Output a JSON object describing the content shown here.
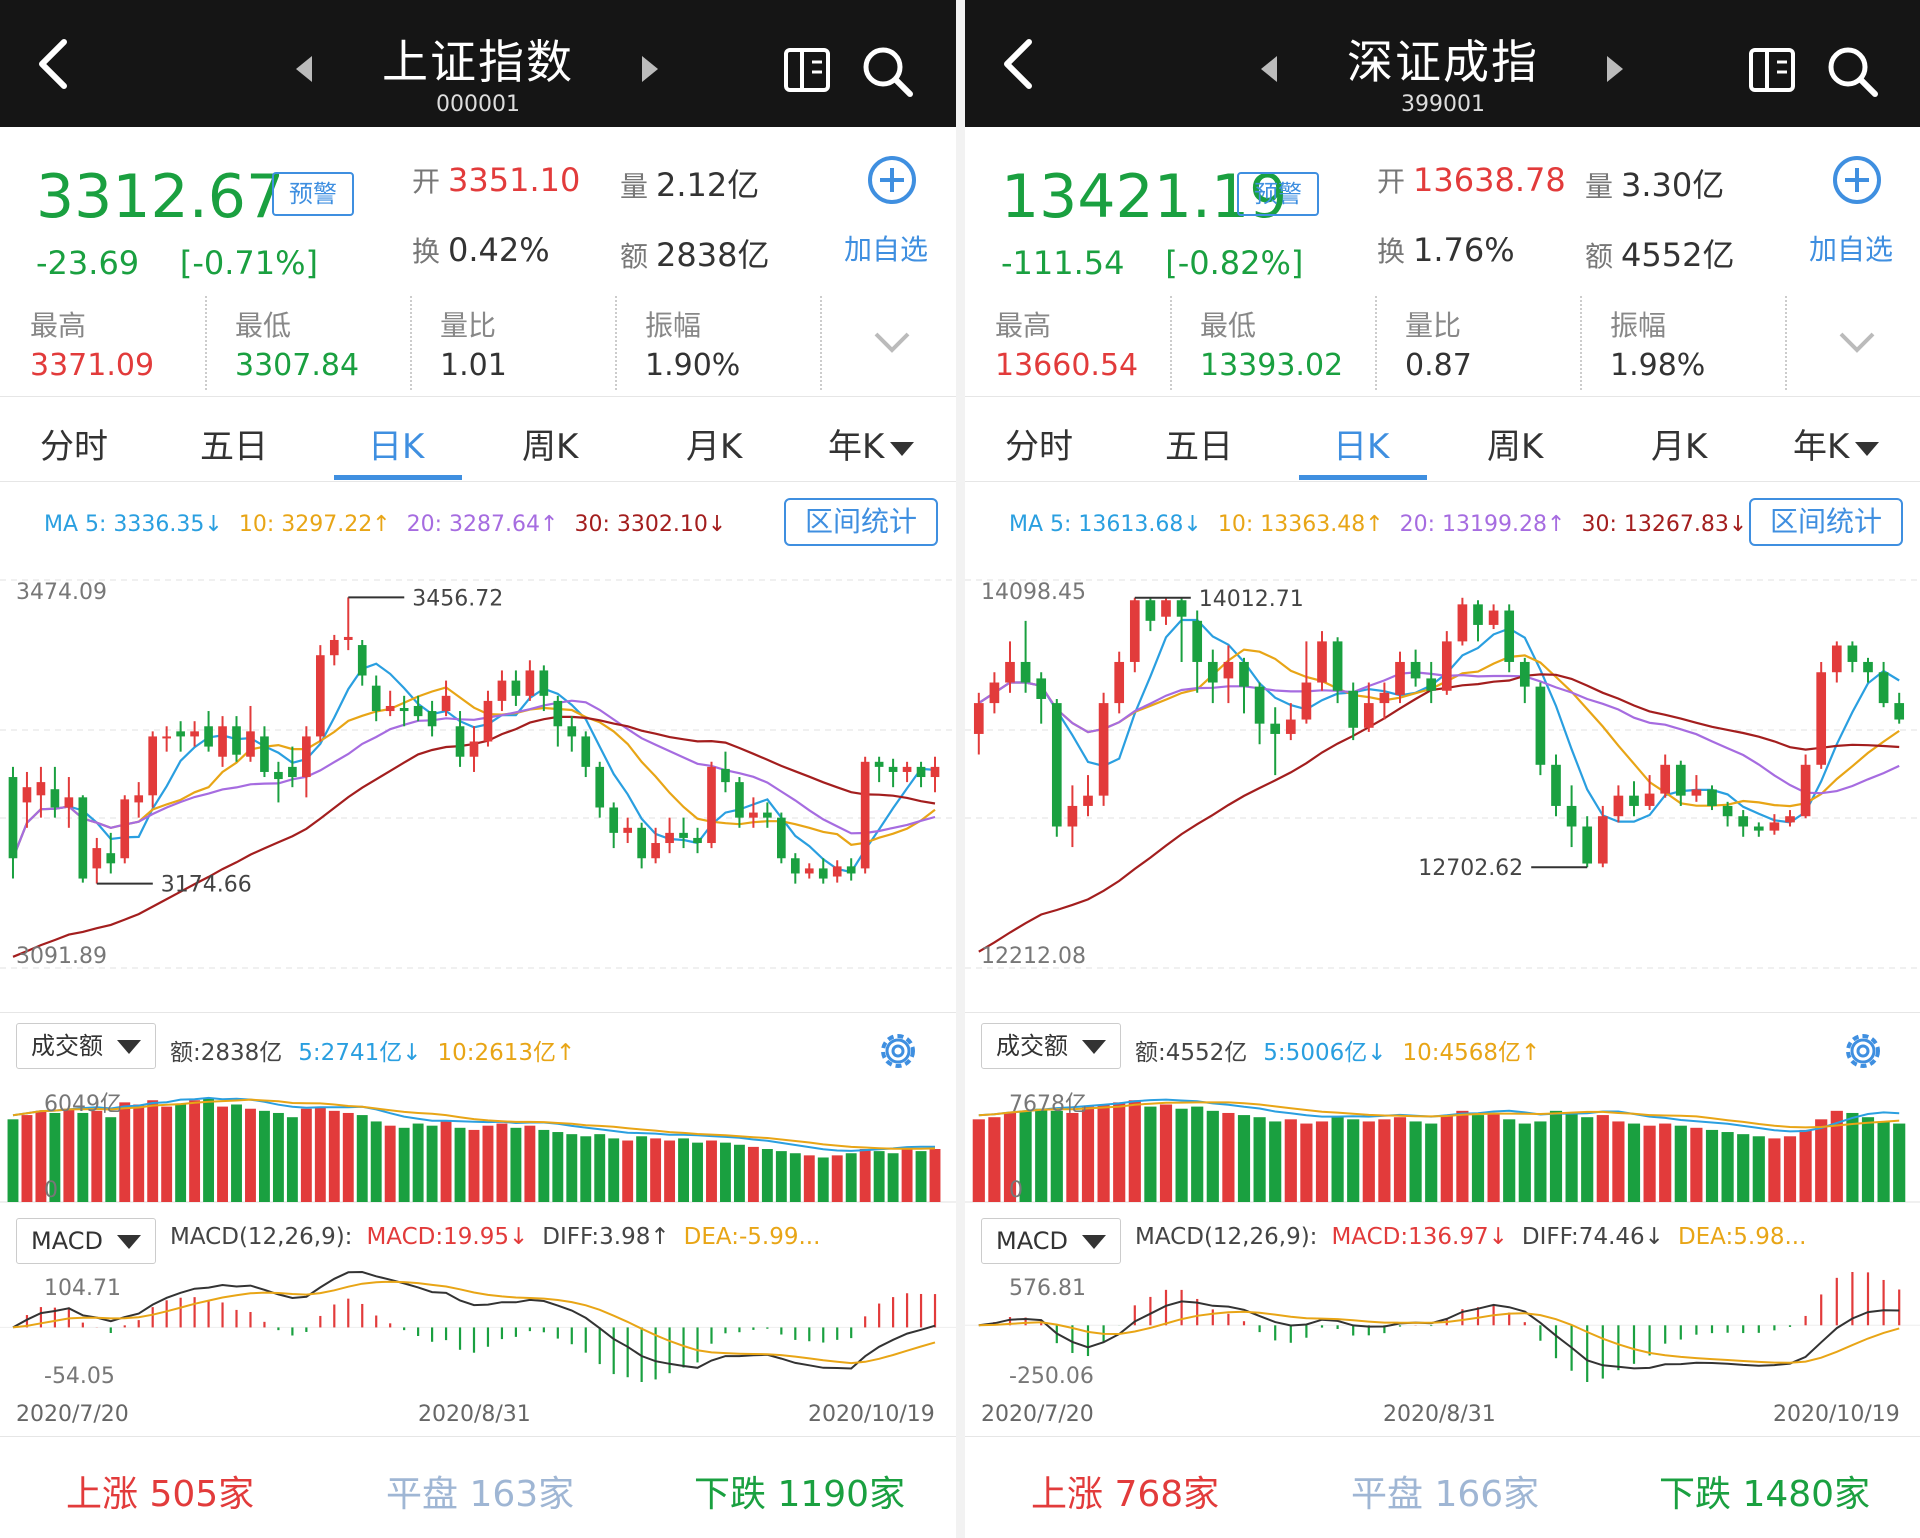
{
  "colors": {
    "up": "#e23b3b",
    "down": "#1aa040",
    "accent": "#3f8fe0",
    "ma5": "#2a9fe0",
    "ma10": "#e8a516",
    "ma20": "#a66ce0",
    "ma30": "#a31e1e"
  },
  "icons": [
    "back-arrow-icon",
    "prev-triangle-icon",
    "next-triangle-icon",
    "screen-toggle-icon",
    "search-icon",
    "plus-circle-icon",
    "chevron-down-icon",
    "gear-icon"
  ],
  "panels": [
    {
      "title": "上证指数",
      "code": "000001",
      "price": "3312.67",
      "warn": "预警",
      "change": "-23.69    [-0.71%]",
      "open_k": "开",
      "open": "3351.10",
      "vol_k": "量",
      "vol": "2.12亿",
      "turn_k": "换",
      "turn": "0.42%",
      "amt_k": "额",
      "amt": "2838亿",
      "add_label": "加自选",
      "stats": [
        {
          "label": "最高",
          "value": "3371.09",
          "color": "#e23b3b"
        },
        {
          "label": "最低",
          "value": "3307.84",
          "color": "#1aa040"
        },
        {
          "label": "量比",
          "value": "1.01",
          "color": "#333"
        },
        {
          "label": "振幅",
          "value": "1.90%",
          "color": "#333"
        }
      ],
      "tabs": [
        "分时",
        "五日",
        "日K",
        "周K",
        "月K",
        "年K"
      ],
      "active_tab": 2,
      "ma": {
        "ma5": "MA 5: 3336.35↓",
        "ma10": "10: 3297.22↑",
        "ma20": "20: 3287.64↑",
        "ma30": "30: 3302.10↓"
      },
      "range_btn": "区间统计",
      "k_axis": {
        "top": "3474.09",
        "bottom": "3091.89",
        "max_label": "3456.72",
        "min_label": "3174.66"
      },
      "vol_dropdown": "成交额",
      "vol_info": {
        "amt": "额:2838亿",
        "ma5": "5:2741亿↓",
        "ma10": "10:2613亿↑"
      },
      "vol_axis": {
        "top": "6049亿",
        "bottom": "0"
      },
      "macd_dropdown": "MACD",
      "macd_info": {
        "params": "MACD(12,26,9):",
        "macd": "MACD:19.95↓",
        "diff": "DIFF:3.98↑",
        "dea": "DEA:-5.99..."
      },
      "macd_axis": {
        "top": "104.71",
        "bottom": "-54.05"
      },
      "dates": [
        "2020/7/20",
        "2020/8/31",
        "2020/10/19"
      ],
      "breadth": {
        "up_k": "上涨",
        "up": "505家",
        "flat_k": "平盘",
        "flat": "163家",
        "down_k": "下跌",
        "down": "1190家"
      },
      "chart_data": {
        "type": "candlestick",
        "ylim": [
          3091.89,
          3474.09
        ],
        "candles": [
          [
            3280,
            3200,
            3290,
            3180
          ],
          [
            3255,
            3270,
            3285,
            3230
          ],
          [
            3262,
            3275,
            3290,
            3240
          ],
          [
            3268,
            3250,
            3290,
            3240
          ],
          [
            3250,
            3260,
            3280,
            3230
          ],
          [
            3260,
            3180,
            3262,
            3176
          ],
          [
            3190,
            3210,
            3220,
            3175
          ],
          [
            3205,
            3195,
            3225,
            3185
          ],
          [
            3200,
            3258,
            3262,
            3195
          ],
          [
            3255,
            3262,
            3275,
            3240
          ],
          [
            3262,
            3320,
            3325,
            3250
          ],
          [
            3318,
            3320,
            3330,
            3305
          ],
          [
            3325,
            3320,
            3335,
            3305
          ],
          [
            3320,
            3325,
            3335,
            3310
          ],
          [
            3330,
            3310,
            3345,
            3305
          ],
          [
            3300,
            3330,
            3340,
            3290
          ],
          [
            3330,
            3302,
            3340,
            3295
          ],
          [
            3300,
            3325,
            3350,
            3295
          ],
          [
            3320,
            3285,
            3330,
            3280
          ],
          [
            3285,
            3278,
            3295,
            3255
          ],
          [
            3290,
            3280,
            3310,
            3270
          ],
          [
            3280,
            3320,
            3330,
            3260
          ],
          [
            3320,
            3400,
            3410,
            3315
          ],
          [
            3400,
            3415,
            3420,
            3390
          ],
          [
            3415,
            3418,
            3457,
            3405
          ],
          [
            3410,
            3380,
            3415,
            3370
          ],
          [
            3370,
            3345,
            3380,
            3335
          ],
          [
            3345,
            3350,
            3365,
            3340
          ],
          [
            3348,
            3345,
            3360,
            3330
          ],
          [
            3350,
            3340,
            3360,
            3335
          ],
          [
            3345,
            3330,
            3355,
            3320
          ],
          [
            3345,
            3360,
            3375,
            3340
          ],
          [
            3330,
            3300,
            3345,
            3290
          ],
          [
            3300,
            3315,
            3330,
            3285
          ],
          [
            3315,
            3355,
            3365,
            3310
          ],
          [
            3355,
            3375,
            3385,
            3345
          ],
          [
            3375,
            3360,
            3385,
            3350
          ],
          [
            3360,
            3385,
            3395,
            3355
          ],
          [
            3385,
            3360,
            3390,
            3345
          ],
          [
            3355,
            3330,
            3360,
            3310
          ],
          [
            3330,
            3320,
            3340,
            3305
          ],
          [
            3320,
            3290,
            3325,
            3280
          ],
          [
            3290,
            3250,
            3295,
            3240
          ],
          [
            3250,
            3225,
            3255,
            3210
          ],
          [
            3225,
            3230,
            3240,
            3215
          ],
          [
            3230,
            3200,
            3235,
            3190
          ],
          [
            3200,
            3215,
            3230,
            3195
          ],
          [
            3215,
            3225,
            3240,
            3205
          ],
          [
            3225,
            3220,
            3240,
            3210
          ],
          [
            3220,
            3215,
            3230,
            3205
          ],
          [
            3215,
            3290,
            3295,
            3210
          ],
          [
            3288,
            3275,
            3305,
            3265
          ],
          [
            3275,
            3240,
            3280,
            3230
          ],
          [
            3240,
            3245,
            3260,
            3230
          ],
          [
            3245,
            3240,
            3255,
            3230
          ],
          [
            3240,
            3200,
            3245,
            3195
          ],
          [
            3200,
            3185,
            3205,
            3175
          ],
          [
            3185,
            3190,
            3195,
            3180
          ],
          [
            3190,
            3180,
            3200,
            3175
          ],
          [
            3182,
            3192,
            3198,
            3176
          ],
          [
            3192,
            3185,
            3200,
            3178
          ],
          [
            3190,
            3295,
            3300,
            3185
          ],
          [
            3295,
            3290,
            3300,
            3275
          ],
          [
            3290,
            3285,
            3298,
            3270
          ],
          [
            3285,
            3290,
            3295,
            3275
          ],
          [
            3290,
            3280,
            3295,
            3270
          ],
          [
            3280,
            3290,
            3300,
            3265
          ]
        ],
        "bar_heights": [
          0.78,
          0.82,
          0.86,
          0.84,
          0.88,
          0.84,
          0.86,
          0.8,
          0.94,
          0.92,
          0.96,
          0.9,
          0.92,
          0.96,
          0.98,
          0.9,
          0.92,
          0.88,
          0.86,
          0.84,
          0.8,
          0.88,
          0.9,
          0.86,
          0.84,
          0.82,
          0.76,
          0.72,
          0.7,
          0.74,
          0.72,
          0.76,
          0.7,
          0.68,
          0.72,
          0.74,
          0.7,
          0.72,
          0.68,
          0.66,
          0.64,
          0.62,
          0.64,
          0.6,
          0.58,
          0.62,
          0.6,
          0.58,
          0.6,
          0.56,
          0.58,
          0.56,
          0.54,
          0.52,
          0.5,
          0.48,
          0.46,
          0.44,
          0.42,
          0.44,
          0.46,
          0.5,
          0.48,
          0.46,
          0.5,
          0.48,
          0.5
        ]
      }
    },
    {
      "title": "深证成指",
      "code": "399001",
      "price": "13421.19",
      "warn": "预警",
      "change": "-111.54    [-0.82%]",
      "open_k": "开",
      "open": "13638.78",
      "vol_k": "量",
      "vol": "3.30亿",
      "turn_k": "换",
      "turn": "1.76%",
      "amt_k": "额",
      "amt": "4552亿",
      "add_label": "加自选",
      "stats": [
        {
          "label": "最高",
          "value": "13660.54",
          "color": "#e23b3b"
        },
        {
          "label": "最低",
          "value": "13393.02",
          "color": "#1aa040"
        },
        {
          "label": "量比",
          "value": "0.87",
          "color": "#333"
        },
        {
          "label": "振幅",
          "value": "1.98%",
          "color": "#333"
        }
      ],
      "tabs": [
        "分时",
        "五日",
        "日K",
        "周K",
        "月K",
        "年K"
      ],
      "active_tab": 2,
      "ma": {
        "ma5": "MA 5: 13613.68↓",
        "ma10": "10: 13363.48↑",
        "ma20": "20: 13199.28↑",
        "ma30": "30: 13267.83↓"
      },
      "range_btn": "区间统计",
      "k_axis": {
        "top": "14098.45",
        "bottom": "12212.08",
        "max_label": "14012.71",
        "min_label": "12702.62"
      },
      "vol_dropdown": "成交额",
      "vol_info": {
        "amt": "额:4552亿",
        "ma5": "5:5006亿↓",
        "ma10": "10:4568亿↑"
      },
      "vol_axis": {
        "top": "7678亿",
        "bottom": "0"
      },
      "macd_dropdown": "MACD",
      "macd_info": {
        "params": "MACD(12,26,9):",
        "macd": "MACD:136.97↓",
        "diff": "DIFF:74.46↓",
        "dea": "DEA:5.98..."
      },
      "macd_axis": {
        "top": "576.81",
        "bottom": "-250.06"
      },
      "dates": [
        "2020/7/20",
        "2020/8/31",
        "2020/10/19"
      ],
      "breadth": {
        "up_k": "上涨",
        "up": "768家",
        "flat_k": "平盘",
        "flat": "166家",
        "down_k": "下跌",
        "down": "1480家"
      },
      "chart_data": {
        "type": "candlestick",
        "ylim": [
          12212.08,
          14098.45
        ],
        "candles": [
          [
            13350,
            13500,
            13550,
            13250
          ],
          [
            13500,
            13600,
            13650,
            13450
          ],
          [
            13600,
            13700,
            13800,
            13550
          ],
          [
            13700,
            13600,
            13900,
            13550
          ],
          [
            13620,
            13520,
            13650,
            13400
          ],
          [
            13500,
            12900,
            13520,
            12850
          ],
          [
            12900,
            13000,
            13100,
            12800
          ],
          [
            13000,
            13050,
            13150,
            12950
          ],
          [
            13050,
            13500,
            13550,
            13000
          ],
          [
            13500,
            13700,
            13750,
            13450
          ],
          [
            13700,
            14000,
            14012,
            13650
          ],
          [
            14000,
            13900,
            14012,
            13850
          ],
          [
            13920,
            14000,
            14012,
            13880
          ],
          [
            14000,
            13920,
            14012,
            13700
          ],
          [
            13900,
            13700,
            13950,
            13550
          ],
          [
            13700,
            13600,
            13760,
            13500
          ],
          [
            13620,
            13700,
            13780,
            13500
          ],
          [
            13700,
            13580,
            13720,
            13450
          ],
          [
            13580,
            13400,
            13600,
            13300
          ],
          [
            13400,
            13350,
            13480,
            13150
          ],
          [
            13350,
            13420,
            13500,
            13320
          ],
          [
            13420,
            13600,
            13800,
            13400
          ],
          [
            13600,
            13800,
            13850,
            13560
          ],
          [
            13800,
            13560,
            13820,
            13500
          ],
          [
            13560,
            13380,
            13600,
            13320
          ],
          [
            13380,
            13500,
            13600,
            13360
          ],
          [
            13500,
            13550,
            13600,
            13420
          ],
          [
            13540,
            13700,
            13750,
            13500
          ],
          [
            13700,
            13620,
            13760,
            13580
          ],
          [
            13620,
            13560,
            13700,
            13500
          ],
          [
            13560,
            13800,
            13850,
            13540
          ],
          [
            13800,
            13980,
            14012,
            13780
          ],
          [
            13980,
            13880,
            14000,
            13800
          ],
          [
            13880,
            13950,
            13980,
            13860
          ],
          [
            13950,
            13700,
            13980,
            13650
          ],
          [
            13700,
            13580,
            13720,
            13500
          ],
          [
            13580,
            13200,
            13600,
            13150
          ],
          [
            13200,
            13000,
            13250,
            12950
          ],
          [
            13000,
            12900,
            13100,
            12800
          ],
          [
            12900,
            12720,
            12950,
            12702
          ],
          [
            12720,
            12950,
            13000,
            12702
          ],
          [
            12950,
            13050,
            13100,
            12920
          ],
          [
            13050,
            13000,
            13120,
            12950
          ],
          [
            13000,
            13060,
            13150,
            12980
          ],
          [
            13060,
            13200,
            13250,
            13040
          ],
          [
            13200,
            13050,
            13220,
            13000
          ],
          [
            13050,
            13080,
            13150,
            13020
          ],
          [
            13080,
            13000,
            13100,
            12980
          ],
          [
            13000,
            12950,
            13020,
            12900
          ],
          [
            12950,
            12900,
            12980,
            12850
          ],
          [
            12900,
            12880,
            12920,
            12850
          ],
          [
            12880,
            12920,
            12960,
            12860
          ],
          [
            12920,
            12950,
            12980,
            12900
          ],
          [
            12950,
            13200,
            13250,
            12940
          ],
          [
            13200,
            13650,
            13700,
            13180
          ],
          [
            13650,
            13780,
            13800,
            13600
          ],
          [
            13780,
            13700,
            13800,
            13650
          ],
          [
            13700,
            13650,
            13720,
            13600
          ],
          [
            13650,
            13500,
            13700,
            13480
          ],
          [
            13500,
            13420,
            13550,
            13400
          ]
        ],
        "bar_heights": [
          0.78,
          0.8,
          0.84,
          0.86,
          0.88,
          0.86,
          0.84,
          0.9,
          0.92,
          0.94,
          0.96,
          0.9,
          0.92,
          0.88,
          0.9,
          0.86,
          0.84,
          0.82,
          0.8,
          0.76,
          0.78,
          0.74,
          0.76,
          0.8,
          0.78,
          0.76,
          0.78,
          0.8,
          0.76,
          0.74,
          0.82,
          0.86,
          0.82,
          0.84,
          0.78,
          0.74,
          0.76,
          0.86,
          0.84,
          0.8,
          0.82,
          0.76,
          0.74,
          0.72,
          0.74,
          0.72,
          0.7,
          0.68,
          0.66,
          0.64,
          0.62,
          0.6,
          0.62,
          0.68,
          0.78,
          0.86,
          0.84,
          0.8,
          0.76,
          0.74
        ]
      }
    }
  ]
}
